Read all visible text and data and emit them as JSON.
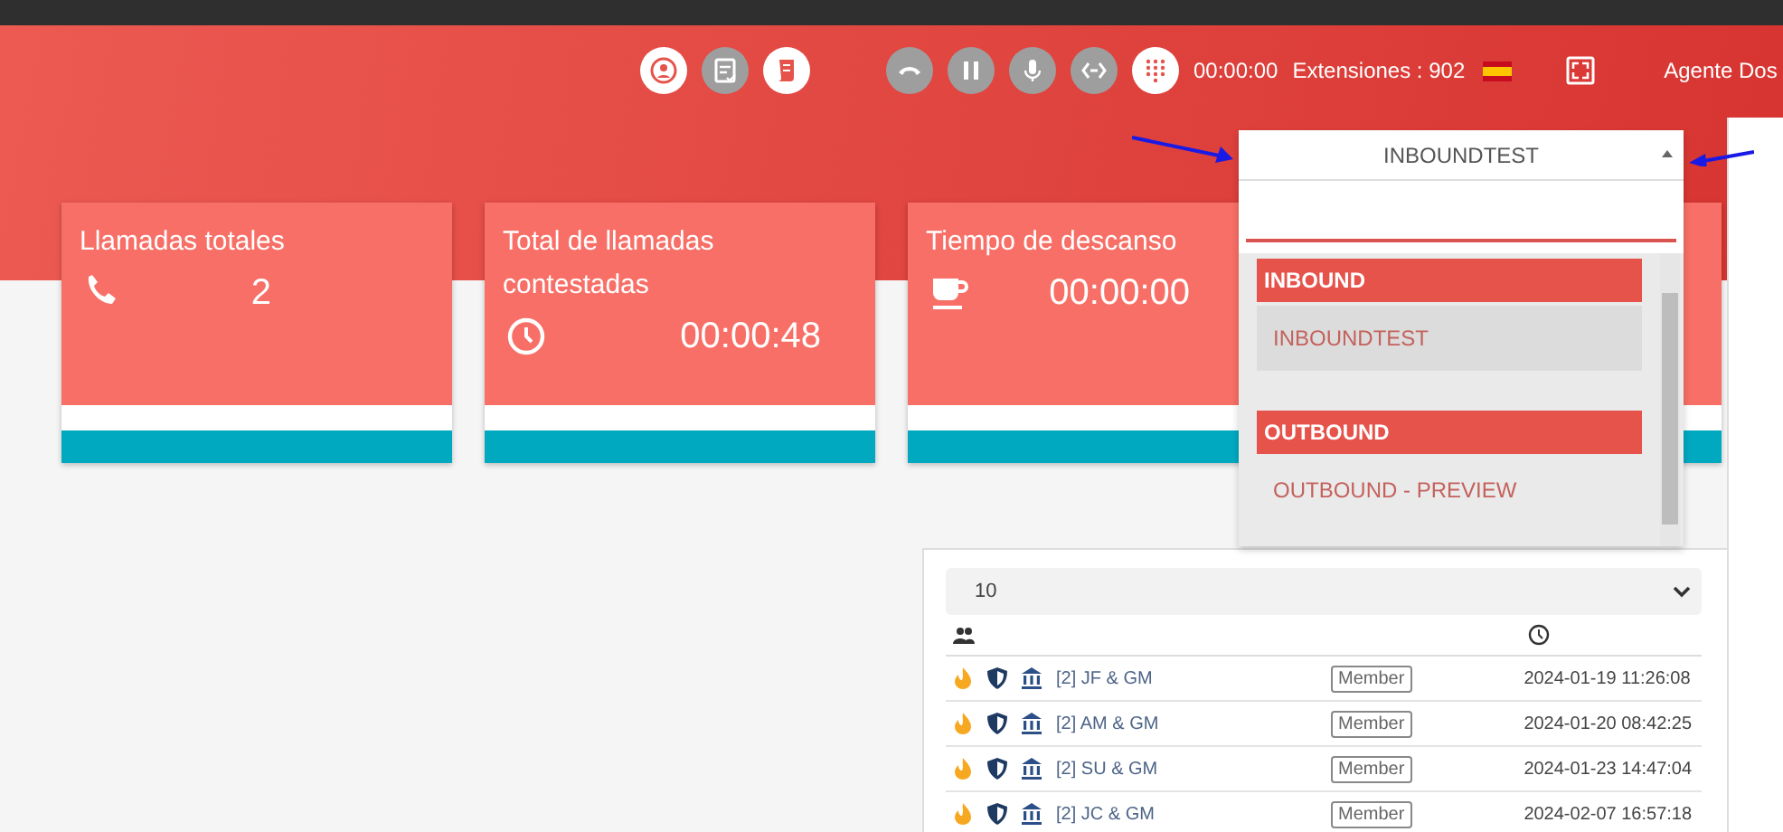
{
  "toolbar": {
    "buttons": [
      {
        "kind": "agents",
        "disabled": false
      },
      {
        "kind": "checklist",
        "disabled": true
      },
      {
        "kind": "script",
        "disabled": false
      },
      {
        "kind": "hangup",
        "disabled": true
      },
      {
        "kind": "pause",
        "disabled": true
      },
      {
        "kind": "mic",
        "disabled": true
      },
      {
        "kind": "transfer",
        "disabled": true
      },
      {
        "kind": "keypad",
        "disabled": false
      }
    ],
    "timer": "00:00:00",
    "extension": "Extensiones : 902",
    "user": "Agente Dos"
  },
  "cards": [
    {
      "kind": "calls",
      "title": "Llamadas totales",
      "value": "2"
    },
    {
      "kind": "answered",
      "title": "Total de llamadas contestadas",
      "value": "00:00:48"
    },
    {
      "kind": "break",
      "title": "Tiempo de descanso",
      "value": "00:00:00"
    },
    {
      "kind": "covered"
    }
  ],
  "campaign_select": {
    "value": "INBOUNDTEST",
    "expanded": true,
    "groups": [
      {
        "label": "INBOUND",
        "options": [
          {
            "label": "INBOUNDTEST",
            "selected": true
          }
        ]
      },
      {
        "label": "OUTBOUND",
        "options": [
          {
            "label": "OUTBOUND - PREVIEW",
            "selected": false
          }
        ]
      }
    ]
  },
  "table": {
    "page_size": "10",
    "rows": [
      {
        "name": "[2] JF & GM",
        "tag": "Member",
        "time": "2024-01-19 11:26:08"
      },
      {
        "name": "[2] AM & GM",
        "tag": "Member",
        "time": "2024-01-20 08:42:25"
      },
      {
        "name": "[2] SU & GM",
        "tag": "Member",
        "time": "2024-01-23 14:47:04"
      },
      {
        "name": "[2] JC & GM",
        "tag": "Member",
        "time": "2024-02-07 16:57:18"
      }
    ]
  }
}
